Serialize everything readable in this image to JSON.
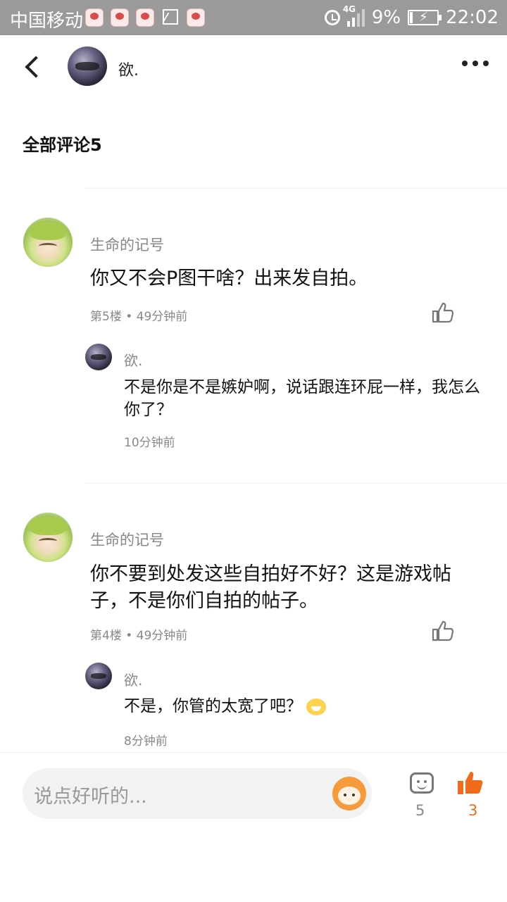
{
  "status_bar": {
    "carrier": "中国移动",
    "network": "4G",
    "battery": "9%",
    "battery_level": 0.09,
    "time": "22:02"
  },
  "header": {
    "username": "欲."
  },
  "section_title": "全部评论5",
  "comments": [
    {
      "author": "生命的记号",
      "text": "你又不会P图干啥？出来发自拍。",
      "meta": "第5楼 • 49分钟前",
      "reply": {
        "author": "欲.",
        "text": "不是你是不是嫉妒啊，说话跟连环屁一样，我怎么你了？",
        "time": "10分钟前"
      }
    },
    {
      "author": "生命的记号",
      "text": "你不要到处发这些自拍好不好？这是游戏帖子，不是你们自拍的帖子。",
      "meta": "第4楼 • 49分钟前",
      "reply": {
        "author": "欲.",
        "text": "不是，你管的太宽了吧？",
        "time": "8分钟前"
      }
    }
  ],
  "bottom_bar": {
    "input_placeholder": "说点好听的...",
    "comment_count": "5",
    "like_count": "3"
  },
  "colors": {
    "accent": "#f26b1d",
    "status_bar": "#9a9a9a"
  },
  "icons": [
    "back-icon",
    "more-icon",
    "like-icon",
    "comment-icon",
    "mascot-icon",
    "alarm-icon",
    "signal-icon",
    "battery-icon"
  ]
}
